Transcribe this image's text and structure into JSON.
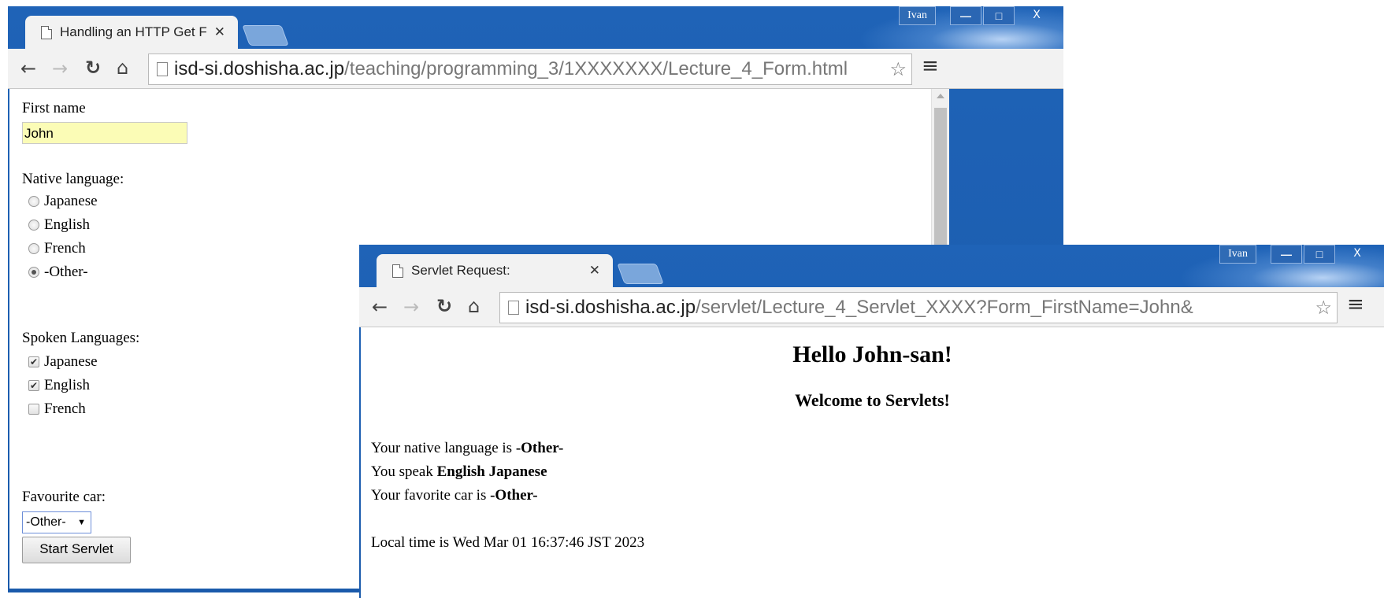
{
  "form_window": {
    "user": "Ivan",
    "controls": {
      "minimize": "—",
      "maximize": "□",
      "close": "X"
    },
    "tab_title": "Handling an HTTP Get F",
    "tab_close": "✕",
    "url_host": "isd-si.doshisha.ac.jp",
    "url_path": "/teaching/programming_3/1XXXXXXX/Lecture_4_Form.html",
    "first_name_label": "First name",
    "first_name_value": "John",
    "native_label": "Native language:",
    "native_options": [
      "Japanese",
      "English",
      "French",
      "-Other-"
    ],
    "native_selected": "-Other-",
    "spoken_label": "Spoken Languages:",
    "spoken_options": [
      {
        "label": "Japanese",
        "checked": true
      },
      {
        "label": "English",
        "checked": true
      },
      {
        "label": "French",
        "checked": false
      }
    ],
    "car_label": "Favourite car:",
    "car_value": "-Other-",
    "submit_label": "Start Servlet"
  },
  "servlet_window": {
    "user": "Ivan",
    "controls": {
      "minimize": "—",
      "maximize": "□",
      "close": "X"
    },
    "tab_title": "Servlet Request:",
    "tab_close": "✕",
    "url_host": "isd-si.doshisha.ac.jp",
    "url_path": "/servlet/Lecture_4_Servlet_XXXX?Form_FirstName=John&",
    "greeting": "Hello John-san!",
    "welcome": "Welcome to Servlets!",
    "native_prefix": "Your native language is ",
    "native_value": "-Other-",
    "speak_prefix": "You speak ",
    "speak_value": "English Japanese",
    "car_prefix": "Your favorite car is ",
    "car_value": "-Other-",
    "local_time": "Local time is Wed Mar 01 16:37:46 JST 2023"
  },
  "colors": {
    "titlebar": "#1f63b7",
    "field_autofill": "#fbfcb6"
  }
}
